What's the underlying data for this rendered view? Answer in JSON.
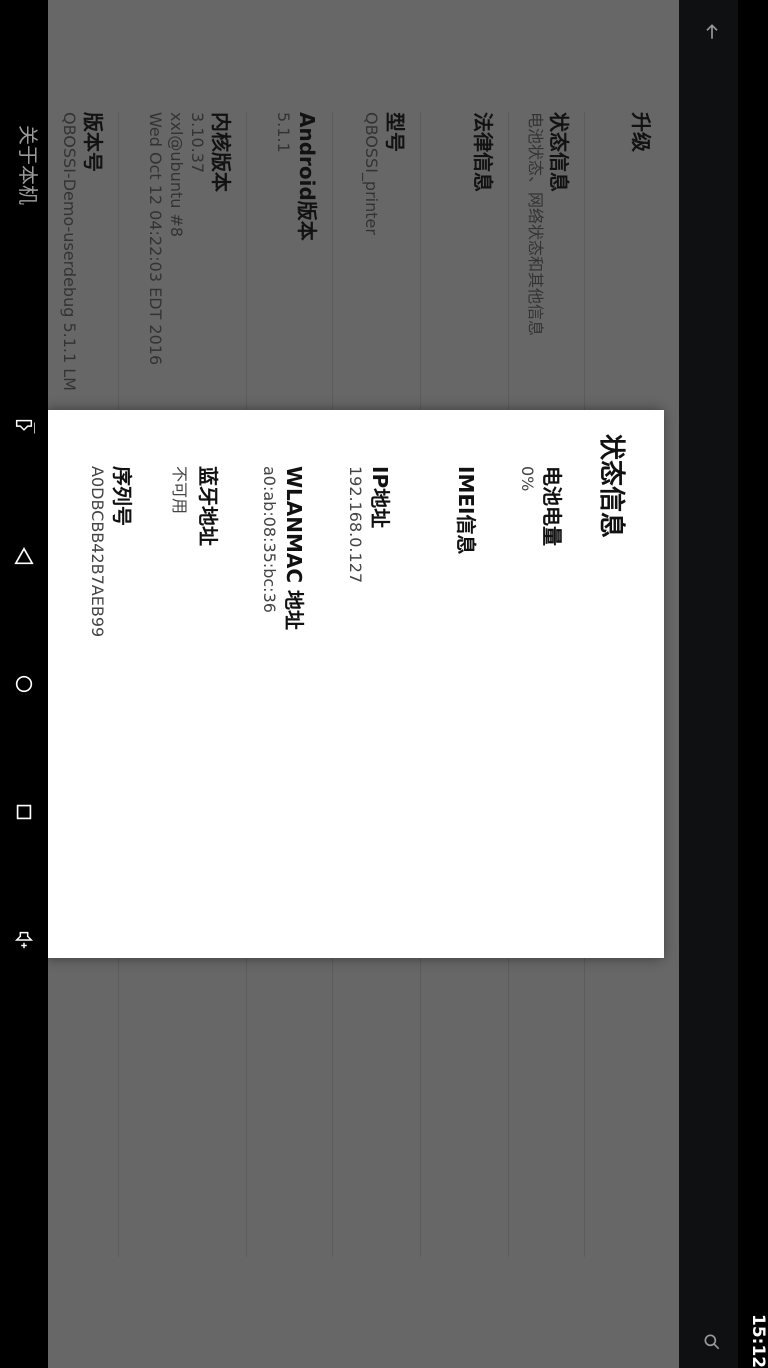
{
  "status_bar": {
    "time": "15:12"
  },
  "app_bar": {
    "title": "关于本机"
  },
  "settings_list": [
    {
      "title": "升级",
      "summary": ""
    },
    {
      "title": "状态信息",
      "summary": "电池状态、网络状态和其他信息"
    },
    {
      "title": "法律信息",
      "summary": ""
    },
    {
      "title": "型号",
      "summary": "QBOSSI_printer"
    },
    {
      "title": "Android版本",
      "summary": "5.1.1"
    },
    {
      "title": "内核版本",
      "summary": "3.10.37",
      "summary2": "xxl@ubuntu #8",
      "summary3": "Wed Oct 12 04:22:03 EDT 2016"
    },
    {
      "title": "版本号",
      "summary": "QBOSSI-Demo-userdebug 5.1.1 LM"
    }
  ],
  "dialog": {
    "title": "状态信息",
    "items": [
      {
        "title": "电池电量",
        "value": "0%"
      },
      {
        "title": "IMEI信息",
        "value": ""
      },
      {
        "title": "IP地址",
        "value": "192.168.0.127"
      },
      {
        "title": "WLANMAC 地址",
        "value": "a0:ab:08:35:bc:36"
      },
      {
        "title": "蓝牙地址",
        "value": "不可用"
      },
      {
        "title": "序列号",
        "value": "A0DBCBB42B7AEB99"
      }
    ]
  },
  "nav_icons": [
    "volume-down-icon",
    "back-triangle-icon",
    "home-circle-icon",
    "recents-square-icon",
    "volume-up-icon"
  ]
}
